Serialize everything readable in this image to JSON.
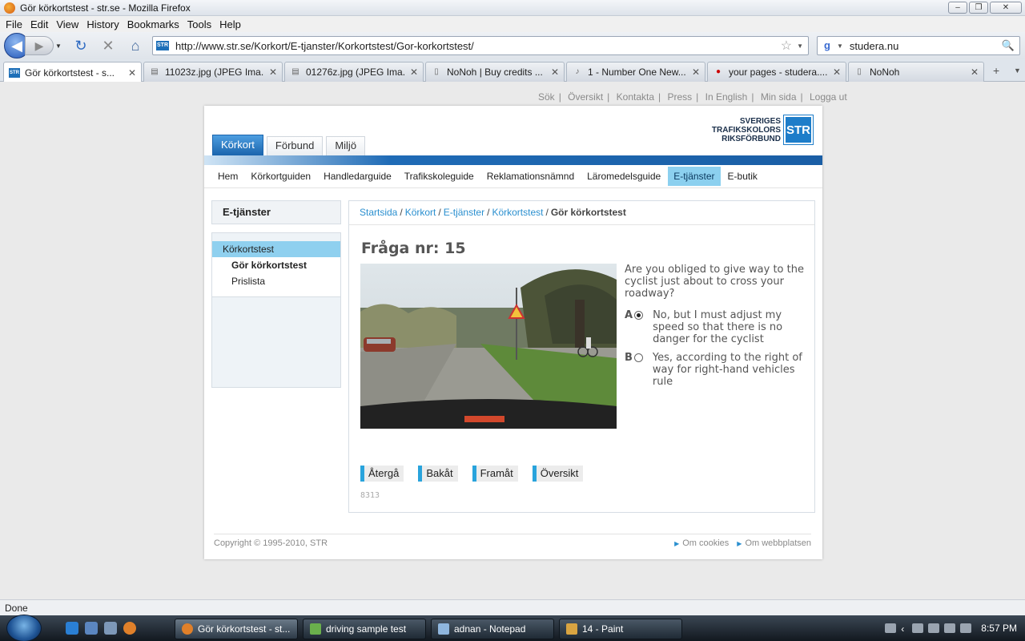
{
  "window": {
    "title": "Gör körkortstest - str.se - Mozilla Firefox"
  },
  "menu": [
    "File",
    "Edit",
    "View",
    "History",
    "Bookmarks",
    "Tools",
    "Help"
  ],
  "nav": {
    "url": "http://www.str.se/Korkort/E-tjanster/Korkortstest/Gor-korkortstest/",
    "search": "studera.nu"
  },
  "tabs": [
    {
      "label": "Gör körkortstest - s...",
      "active": true
    },
    {
      "label": "11023z.jpg (JPEG Ima..."
    },
    {
      "label": "01276z.jpg (JPEG Ima..."
    },
    {
      "label": "NoNoh | Buy credits ..."
    },
    {
      "label": "1 - Number One New..."
    },
    {
      "label": "your pages - studera...."
    },
    {
      "label": "NoNoh"
    }
  ],
  "site": {
    "toplinks": [
      "Sök",
      "Översikt",
      "Kontakta",
      "Press",
      "In English",
      "Min sida",
      "Logga ut"
    ],
    "logo": {
      "line1": "SVERIGES",
      "line2": "TRAFIKSKOLORS",
      "line3": "RIKSFÖRBUND",
      "mark": "STR"
    },
    "maintabs": [
      "Körkort",
      "Förbund",
      "Miljö"
    ],
    "subnav": [
      "Hem",
      "Körkortguiden",
      "Handledarguide",
      "Trafikskoleguide",
      "Reklamationsnämnd",
      "Läromedelsguide",
      "E-tjänster",
      "E-butik"
    ],
    "sidebar": {
      "heading": "E-tjänster",
      "items": [
        "Körkortstest",
        "Gör körkortstest",
        "Prislista"
      ]
    },
    "breadcrumb": {
      "items": [
        "Startsida",
        "Körkort",
        "E-tjänster",
        "Körkortstest"
      ],
      "current": "Gör körkortstest"
    },
    "quiz": {
      "title": "Fråga nr: 15",
      "question": "Are you obliged to give way to the cyclist just about to cross your roadway?",
      "answers": [
        {
          "letter": "A",
          "text": "No, but I must adjust my speed so that there is no danger for the cyclist",
          "checked": true
        },
        {
          "letter": "B",
          "text": "Yes, according to the right of way for right-hand vehicles rule",
          "checked": false
        }
      ],
      "buttons": [
        "Återgå",
        "Bakåt",
        "Framåt",
        "Översikt"
      ],
      "code": "8313"
    },
    "footer": {
      "copyright": "Copyright © 1995-2010, STR",
      "links": [
        "Om cookies",
        "Om webbplatsen"
      ]
    }
  },
  "status": "Done",
  "taskbar": {
    "buttons": [
      "Gör körkortstest - st...",
      "driving sample test",
      "adnan - Notepad",
      "14 - Paint"
    ],
    "clock": "8:57 PM"
  },
  "colors": {
    "accent": "#29a3dc",
    "brand": "#1e7dc9",
    "link": "#2a8fcf"
  }
}
